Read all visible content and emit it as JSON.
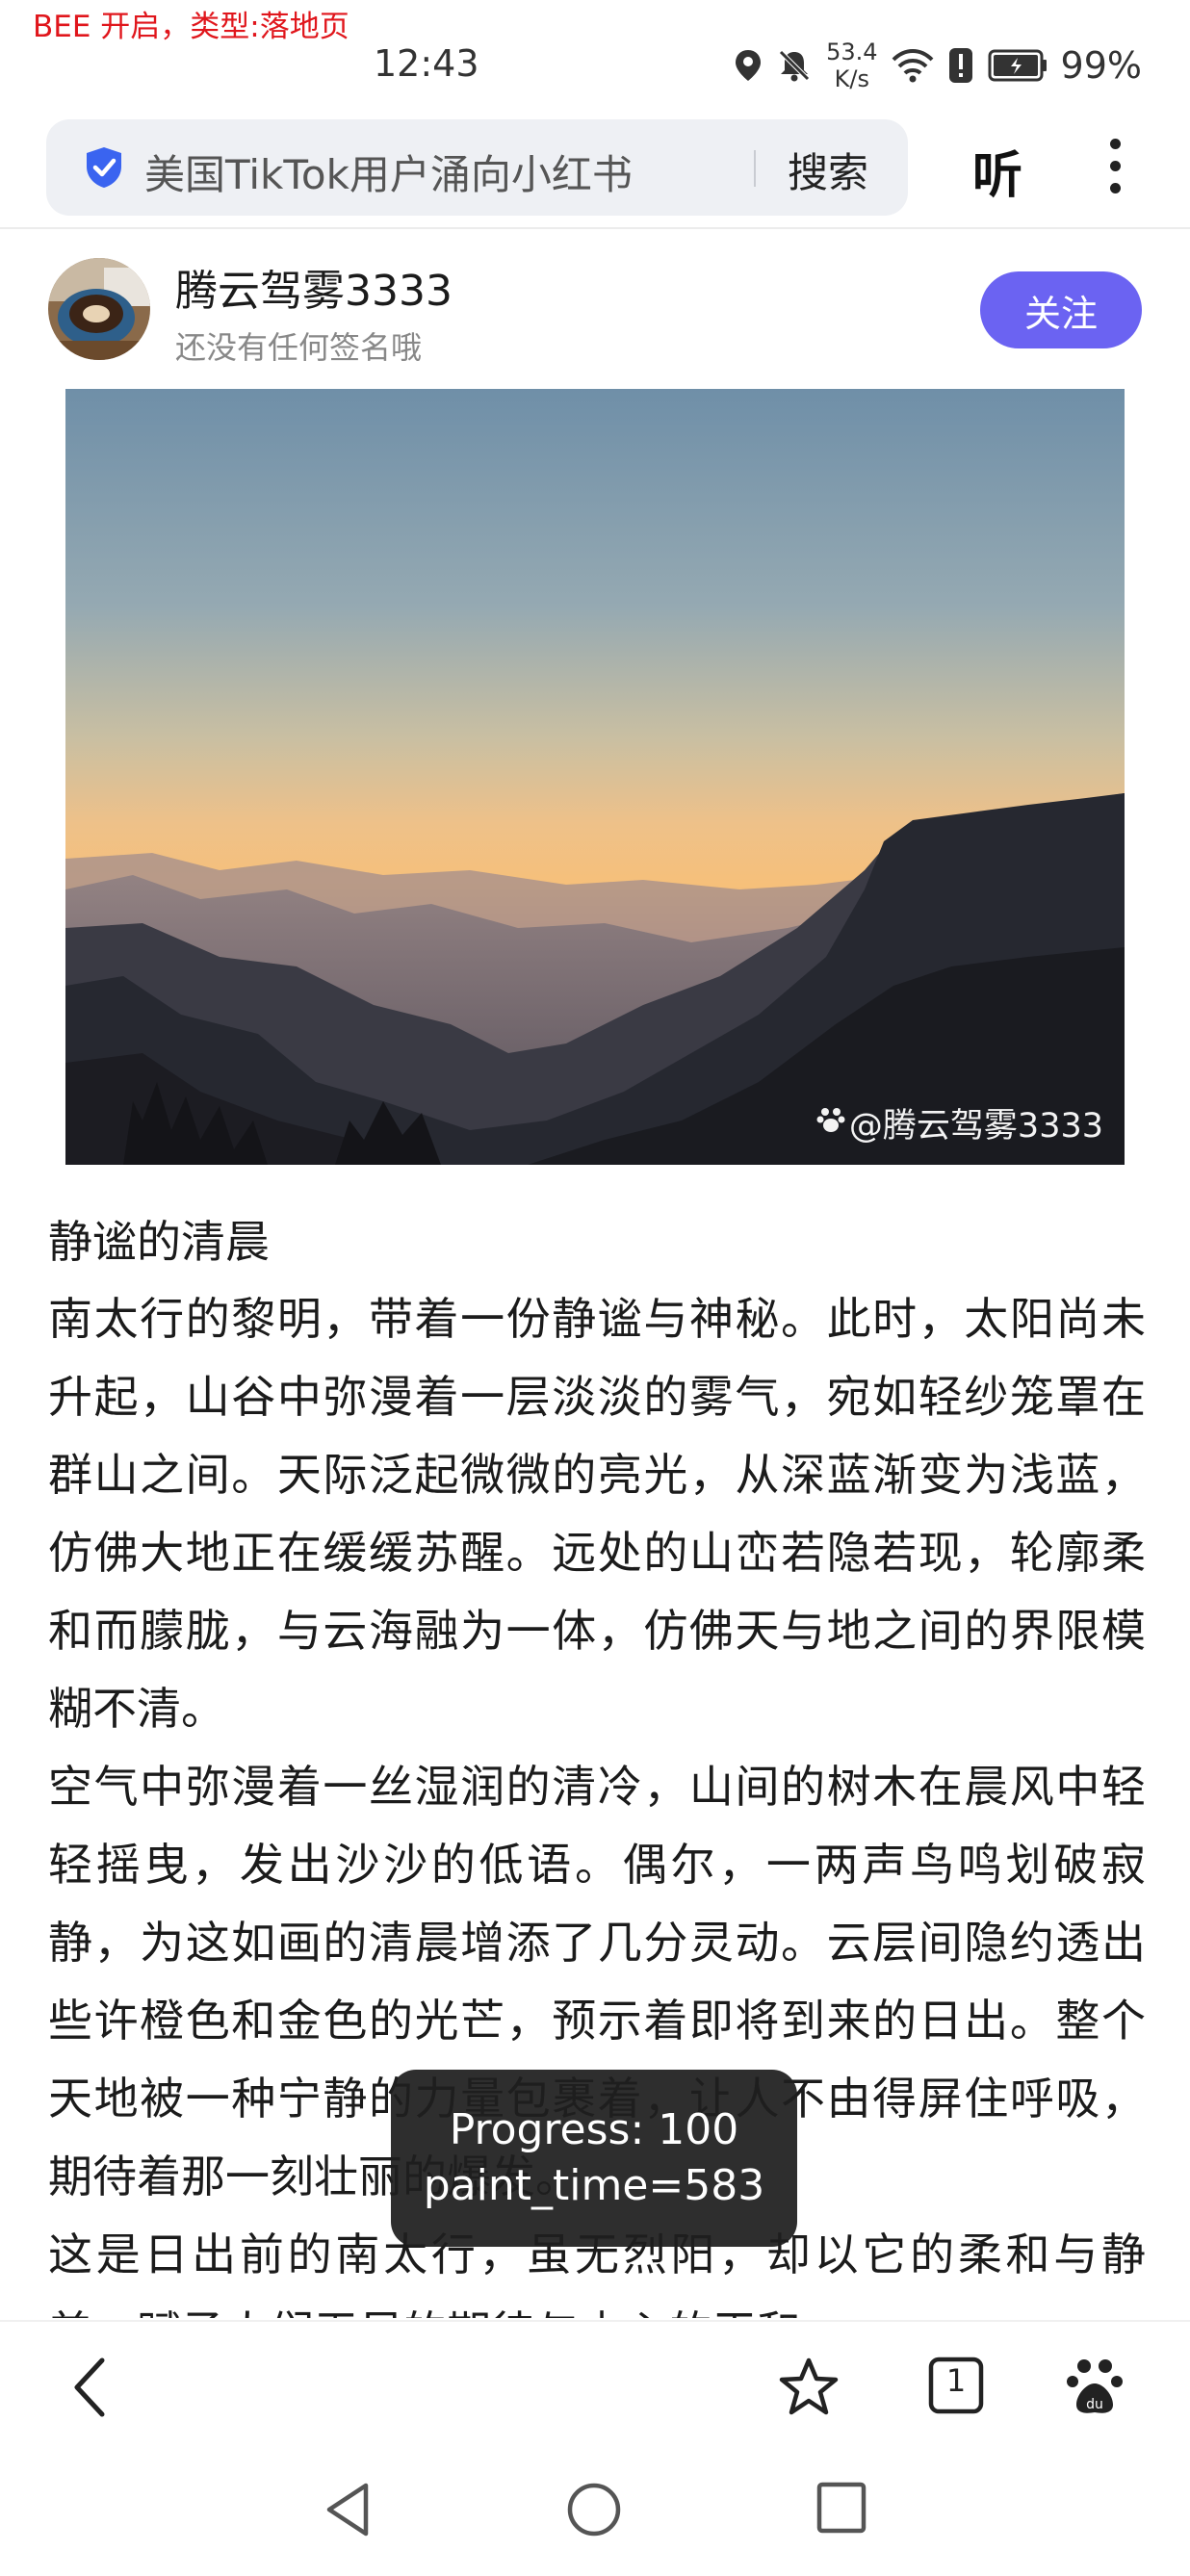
{
  "debug": {
    "label": "BEE 开启，类型:落地页"
  },
  "status_bar": {
    "time": "12:43",
    "net_speed_value": "53.4",
    "net_speed_unit": "K/s",
    "battery": "99%",
    "icons": [
      "location-icon",
      "mute-bell-icon",
      "wifi-icon",
      "alert-icon",
      "battery-icon"
    ]
  },
  "browser": {
    "search_query": "美国TikTok用户涌向小红书",
    "search_button": "搜索",
    "listen_button": "听"
  },
  "author": {
    "name": "腾云驾雾3333",
    "signature": "还没有任何签名哦",
    "follow_label": "关注"
  },
  "image": {
    "watermark": "@腾云驾雾3333"
  },
  "article": {
    "title": "静谧的清晨",
    "paragraphs": [
      "南太行的黎明，带着一份静谧与神秘。此时，太阳尚未升起，山谷中弥漫着一层淡淡的雾气，宛如轻纱笼罩在群山之间。天际泛起微微的亮光，从深蓝渐变为浅蓝，仿佛大地正在缓缓苏醒。远处的山峦若隐若现，轮廓柔和而朦胧，与云海融为一体，仿佛天与地之间的界限模糊不清。",
      "空气中弥漫着一丝湿润的清冷，山间的树木在晨风中轻轻摇曳，发出沙沙的低语。偶尔，一两声鸟鸣划破寂静，为这如画的清晨增添了几分灵动。云层间隐约透出些许橙色和金色的光芒，预示着即将到来的日出。整个天地被一种宁静的力量包裹着，让人不由得屏住呼吸，期待着那一刻壮丽的爆发。",
      "这是日出前的南太行，虽无烈阳，却以它的柔和与静美，赋予人们无尽的期待与内心的平和。"
    ]
  },
  "toast": {
    "progress": "Progress: 100",
    "paint_time": "paint_time=583"
  },
  "toolbar": {
    "tab_count": "1"
  }
}
